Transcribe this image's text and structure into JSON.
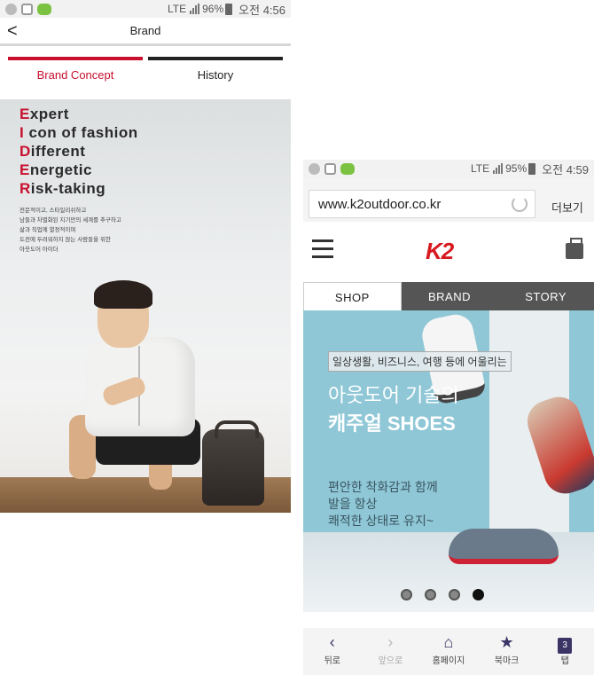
{
  "left": {
    "status": {
      "network": "LTE",
      "battery": "96%",
      "time": "오전 4:56"
    },
    "appbar": {
      "back": "<",
      "title": "Brand"
    },
    "tabs": [
      "Brand Concept",
      "History"
    ],
    "acrostic": [
      {
        "cap": "E",
        "rest": "xpert"
      },
      {
        "cap": "I",
        "rest": " con of fashion"
      },
      {
        "cap": "D",
        "rest": "ifferent"
      },
      {
        "cap": "E",
        "rest": "nergetic"
      },
      {
        "cap": "R",
        "rest": "isk-taking"
      }
    ],
    "korean_lines": [
      "전문적이고, 스타일리쉬하고",
      "남들과 차별화된 지기만의 세계를 추구하고",
      "삶과 직업에 열정적이며",
      "도전에 두려워하지 않는 사람들을 위한",
      "아웃도어 아이더"
    ]
  },
  "right": {
    "status": {
      "network": "LTE",
      "battery": "95%",
      "time": "오전 4:59"
    },
    "browser": {
      "url": "www.k2outdoor.co.kr",
      "more": "더보기"
    },
    "brand_logo": "K2",
    "nav": [
      "SHOP",
      "BRAND",
      "STORY"
    ],
    "banner": {
      "tag": "일상생활, 비즈니스, 여행 등에 어울리는",
      "line1": "아웃도어 기술의",
      "line2": "캐주얼 SHOES",
      "body": [
        "편안한 착화감과 함께",
        "발을 항상",
        "쾌적한 상태로 유지~"
      ],
      "dots_total": 4,
      "dots_active": 4
    },
    "bottom_nav": {
      "back": "뒤로",
      "forward": "앞으로",
      "home": "홈페이지",
      "bookmark": "북마크",
      "tabs": "탭",
      "tab_count": "3"
    }
  }
}
